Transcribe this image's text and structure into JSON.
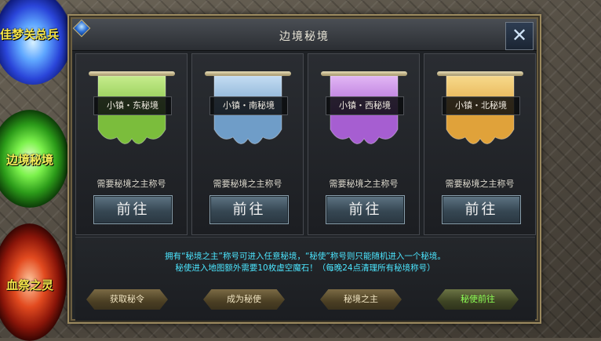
{
  "dialog": {
    "title": "边境秘境",
    "close_glyph": "✕"
  },
  "side_portals": [
    {
      "label": "佳梦关总兵",
      "color": "blue"
    },
    {
      "label": "边境秘境",
      "color": "green"
    },
    {
      "label": "血祭之灵",
      "color": "red"
    }
  ],
  "realms": [
    {
      "name": "小镇・东秘境",
      "requirement": "需要秘境之主称号",
      "button": "前往",
      "banner_color": "#7bbd3c",
      "banner_light": "#c6ec8c"
    },
    {
      "name": "小镇・南秘境",
      "requirement": "需要秘境之主称号",
      "button": "前往",
      "banner_color": "#6f9dc8",
      "banner_light": "#c3dcf2"
    },
    {
      "name": "小镇・西秘境",
      "requirement": "需要秘境之主称号",
      "button": "前往",
      "banner_color": "#a65ed1",
      "banner_light": "#e2b6f4"
    },
    {
      "name": "小镇・北秘境",
      "requirement": "需要秘境之主称号",
      "button": "前往",
      "banner_color": "#e0a23a",
      "banner_light": "#f7d98b"
    }
  ],
  "info": {
    "line1": "拥有“秘境之主”称号可进入任意秘境，“秘使”称号则只能随机进入一个秘境。",
    "line2": "秘使进入地图额外需要10枚虚空魔石！（每晚24点清理所有秘境称号）"
  },
  "actions": [
    {
      "label": "获取秘令"
    },
    {
      "label": "成为秘使"
    },
    {
      "label": "秘境之主"
    },
    {
      "label": "秘使前往"
    }
  ]
}
